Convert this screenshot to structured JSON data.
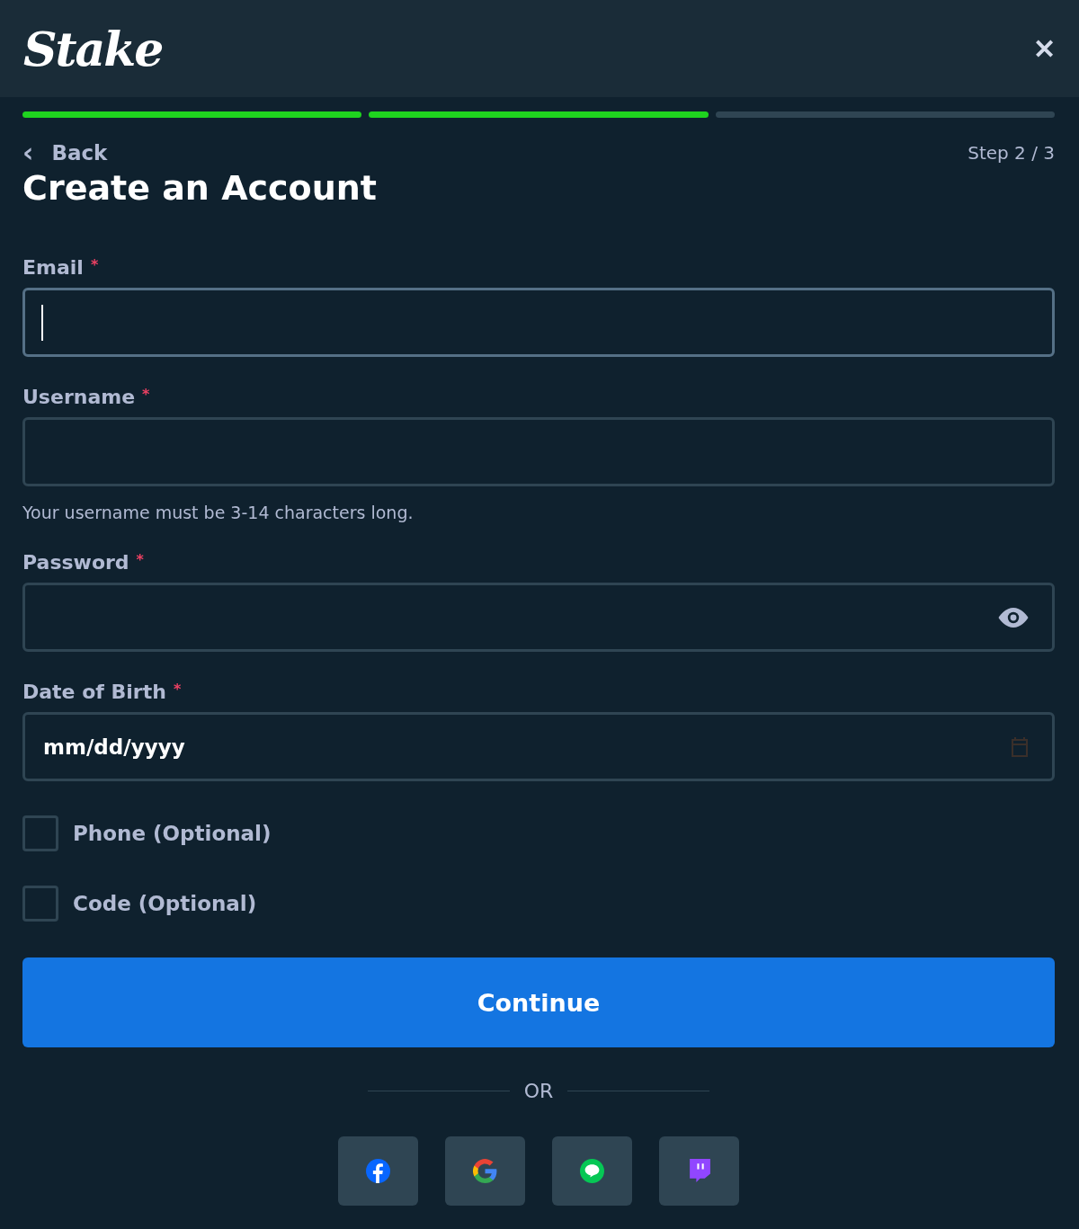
{
  "header": {
    "logo": "Stake",
    "close": "✕"
  },
  "progress": [
    {
      "filled": true
    },
    {
      "filled": true
    },
    {
      "filled": false
    }
  ],
  "back": {
    "icon": "‹",
    "label": "Back"
  },
  "step": "Step 2 / 3",
  "title": "Create an Account",
  "fields": [
    {
      "kind": "email",
      "label": "Email",
      "required": "*",
      "focused": true
    },
    {
      "kind": "text",
      "label": "Username",
      "required": "*",
      "focused": false,
      "hint": "Your username must be 3-14 characters long."
    },
    {
      "kind": "password",
      "label": "Password",
      "required": "*",
      "focused": false
    },
    {
      "kind": "date",
      "label": "Date of Birth",
      "required": "*",
      "focused": false,
      "value": "mm/dd/yyyy"
    }
  ],
  "options": [
    {
      "label": "Phone (Optional)",
      "checked": false
    },
    {
      "label": "Code (Optional)",
      "checked": false
    }
  ],
  "continue": "Continue",
  "divider": "OR",
  "social": [
    {
      "kind": "facebook"
    },
    {
      "kind": "google"
    },
    {
      "kind": "line"
    },
    {
      "kind": "twitch"
    }
  ]
}
